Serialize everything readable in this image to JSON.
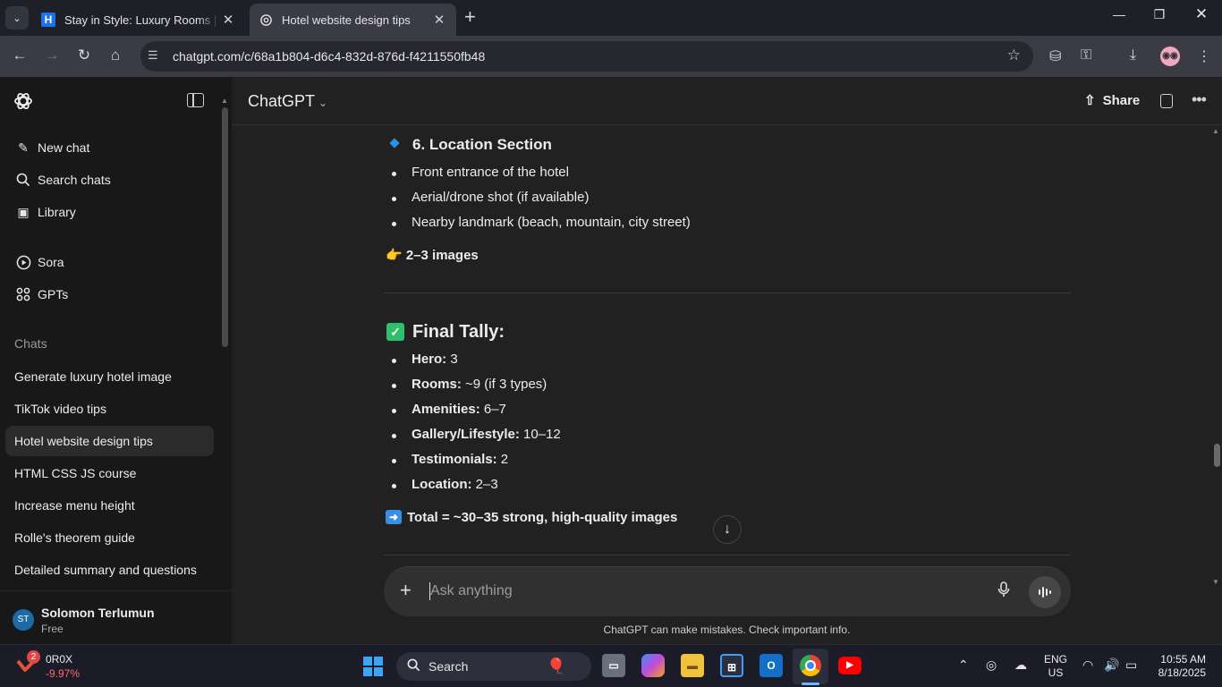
{
  "browser": {
    "tabs": [
      {
        "title": "Stay in Style: Luxury Rooms | Pa",
        "favicon": "H"
      },
      {
        "title": "Hotel website design tips"
      }
    ],
    "url": "chatgpt.com/c/68a1b804-d6c4-832d-876d-f4211550fb48"
  },
  "sidebar": {
    "nav": [
      {
        "label": "New chat",
        "icon": "new-chat-icon"
      },
      {
        "label": "Search chats",
        "icon": "search-icon"
      },
      {
        "label": "Library",
        "icon": "library-icon"
      }
    ],
    "apps": [
      {
        "label": "Sora",
        "icon": "play-circle-icon"
      },
      {
        "label": "GPTs",
        "icon": "grid-icon"
      }
    ],
    "chats_heading": "Chats",
    "chats": [
      "Generate luxury hotel image",
      "TikTok video tips",
      "Hotel website design tips",
      "HTML CSS JS course",
      "Increase menu height",
      "Rolle's theorem guide",
      "Detailed summary and questions"
    ],
    "user": {
      "initials": "ST",
      "name": "Solomon Terlumun",
      "plan": "Free"
    }
  },
  "header": {
    "model": "ChatGPT",
    "share_label": "Share"
  },
  "message": {
    "location_heading": "6. Location Section",
    "location_items": [
      "Front entrance of the hotel",
      "Aerial/drone shot (if available)",
      "Nearby landmark (beach, mountain, city street)"
    ],
    "location_note": "2–3 images",
    "tally_heading": "Final Tally:",
    "tally_items": [
      {
        "key": "Hero:",
        "val": " 3"
      },
      {
        "key": "Rooms:",
        "val": " ~9 (if 3 types)"
      },
      {
        "key": "Amenities:",
        "val": " 6–7"
      },
      {
        "key": "Gallery/Lifestyle:",
        "val": " 10–12"
      },
      {
        "key": "Testimonials:",
        "val": " 2"
      },
      {
        "key": "Location:",
        "val": " 2–3"
      }
    ],
    "total": "Total = ~30–35 strong, high-quality images"
  },
  "composer": {
    "placeholder": "Ask anything",
    "disclaimer": "ChatGPT can make mistakes. Check important info."
  },
  "taskbar": {
    "stock_name": "0R0X",
    "stock_change": "-9.97%",
    "stock_badge": "2",
    "search_label": "Search",
    "lang_top": "ENG",
    "lang_bottom": "US",
    "time": "10:55 AM",
    "date": "8/18/2025"
  }
}
